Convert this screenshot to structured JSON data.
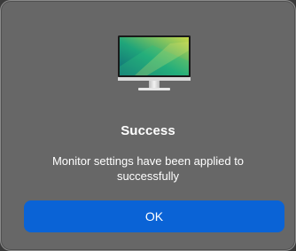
{
  "dialog": {
    "icon": "monitor-icon",
    "title": "Success",
    "message_line1": "Monitor settings have been applied to",
    "message_line2": "successfully",
    "ok_label": "OK"
  },
  "colors": {
    "dialog_bg": "#676767",
    "accent": "#0a63d6",
    "text": "#ffffff"
  }
}
